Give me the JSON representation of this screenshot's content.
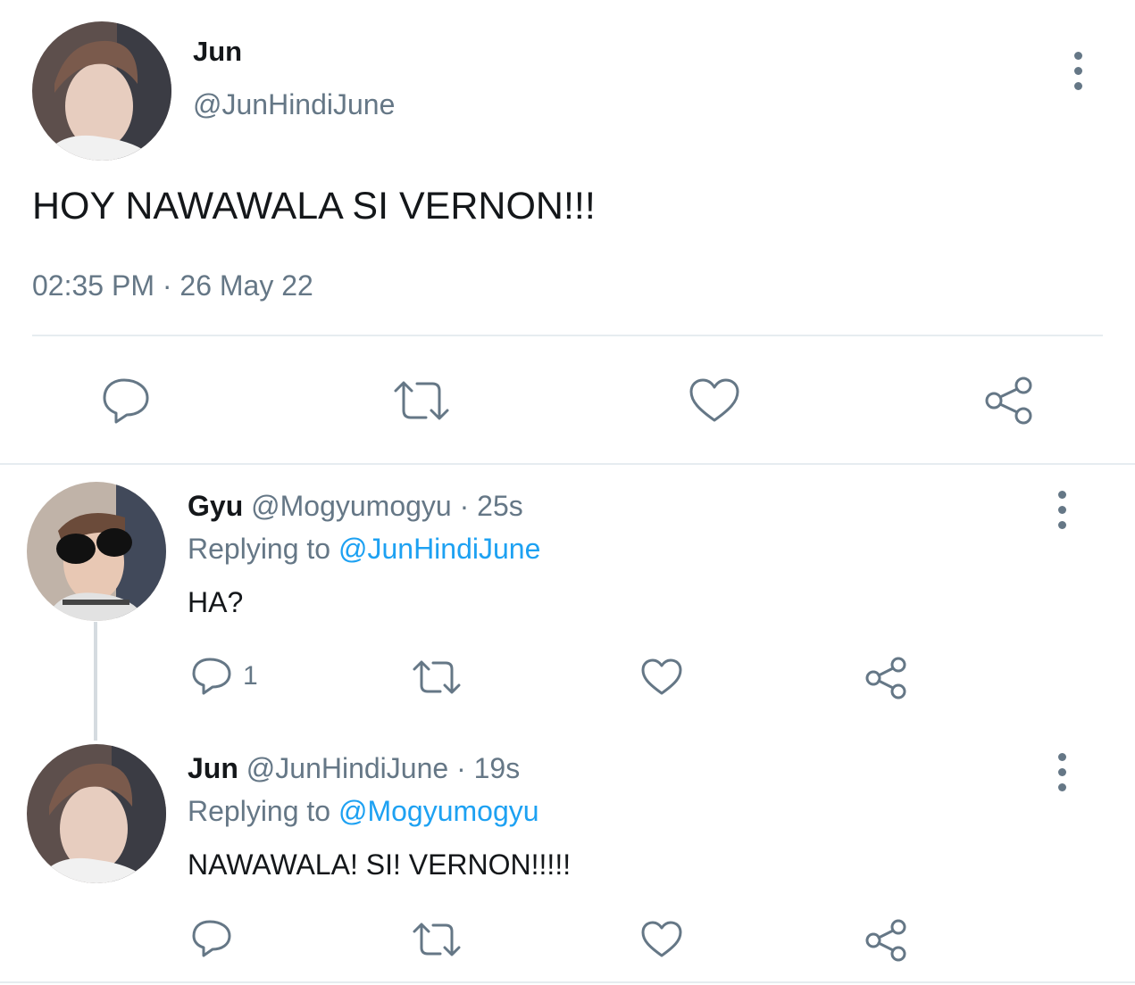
{
  "main_tweet": {
    "author": {
      "display_name": "Jun",
      "handle": "@JunHindiJune"
    },
    "text": "HOY NAWAWALA SI VERNON!!!",
    "timestamp": "02:35 PM · 26 May 22",
    "actions": {
      "reply_icon": "reply-icon",
      "retweet_icon": "retweet-icon",
      "like_icon": "heart-icon",
      "share_icon": "share-icon"
    }
  },
  "replies": [
    {
      "display_name": "Gyu",
      "handle": "@Mogyumogyu",
      "time": "· 25s",
      "replying_prefix": "Replying to",
      "replying_to": "@JunHindiJune",
      "text": "HA?",
      "reply_count": "1"
    },
    {
      "display_name": "Jun",
      "handle": "@JunHindiJune",
      "time": "· 19s",
      "replying_prefix": "Replying to",
      "replying_to": "@Mogyumogyu",
      "text": "NAWAWALA! SI! VERNON!!!!!",
      "reply_count": ""
    }
  ],
  "colors": {
    "text": "#14171a",
    "secondary": "#657786",
    "link": "#1da1f2",
    "divider": "#e6ecf0"
  }
}
